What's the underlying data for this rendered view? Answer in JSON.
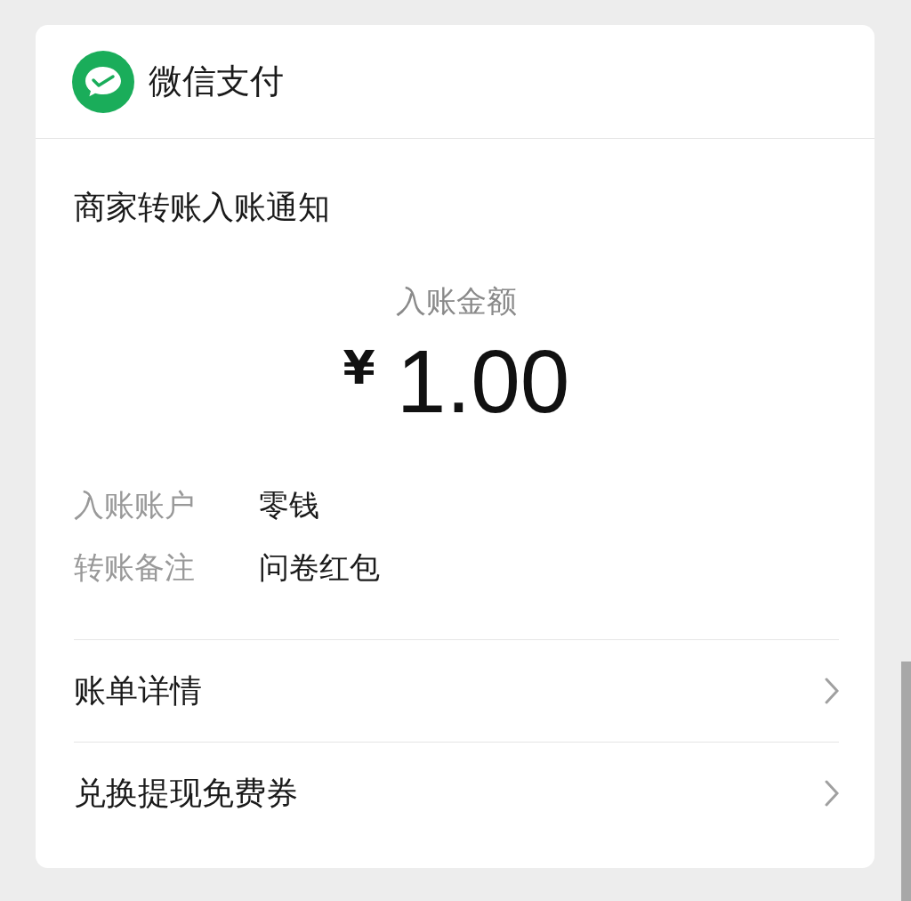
{
  "header": {
    "title": "微信支付"
  },
  "notice": {
    "title": "商家转账入账通知",
    "amount_label": "入账金额",
    "currency": "¥",
    "amount": "1.00"
  },
  "details": [
    {
      "label": "入账账户",
      "value": "零钱"
    },
    {
      "label": "转账备注",
      "value": "问卷红包"
    }
  ],
  "links": [
    {
      "label": "账单详情"
    },
    {
      "label": "兑换提现免费券"
    }
  ]
}
